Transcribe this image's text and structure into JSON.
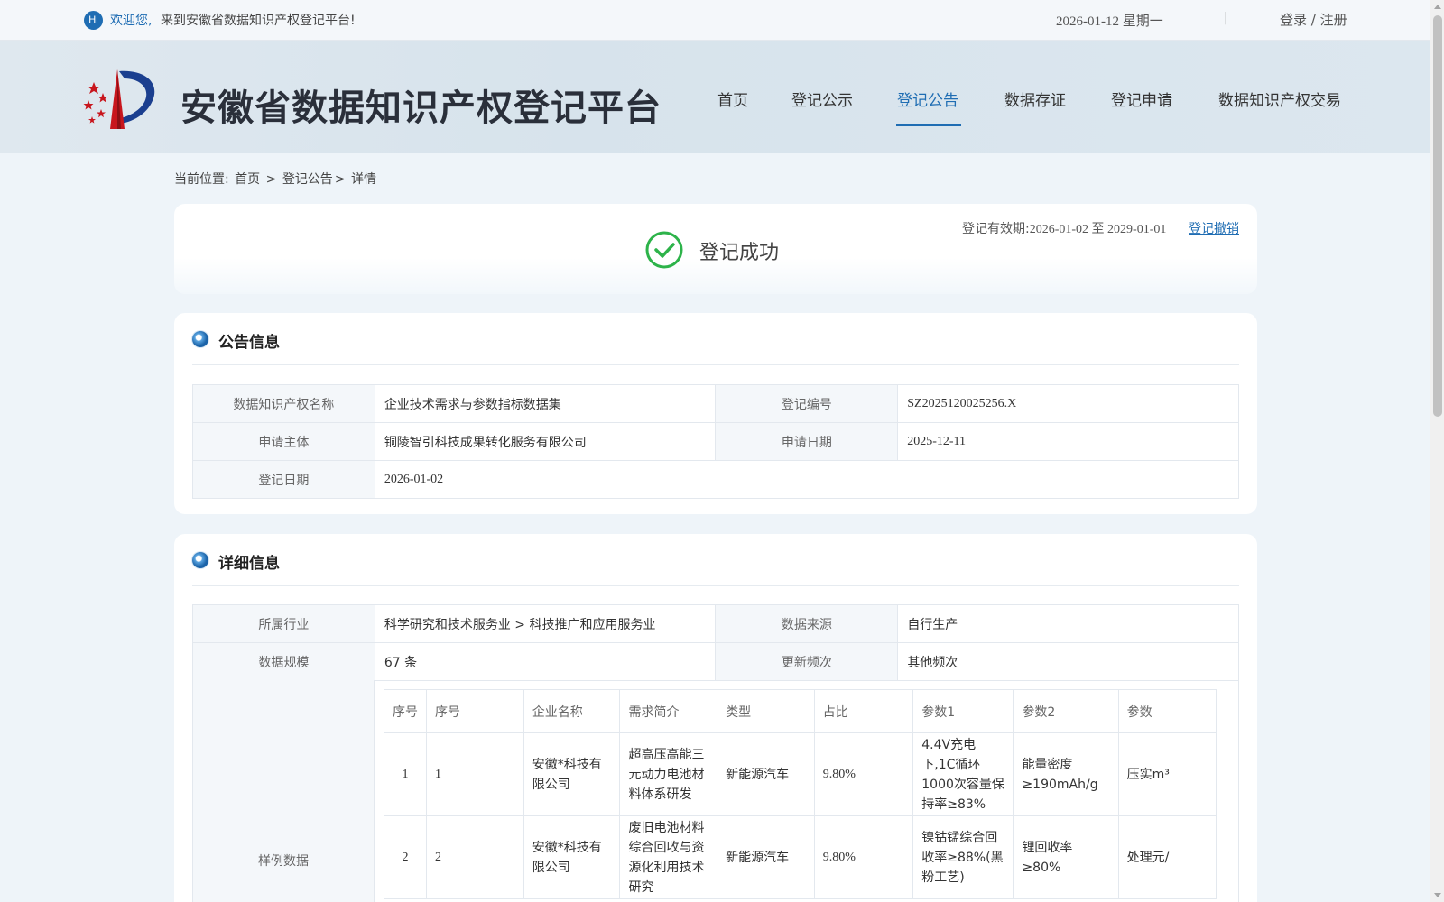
{
  "topbar": {
    "hi_badge": "Hi",
    "welcome_em": "欢迎您,",
    "welcome_text": "来到安徽省数据知识产权登记平台!",
    "date": "2026-01-12 星期一",
    "separator": "|",
    "auth_link": "登录 / 注册"
  },
  "header": {
    "site_title": "安徽省数据知识产权登记平台",
    "nav": [
      {
        "label": "首页"
      },
      {
        "label": "登记公示"
      },
      {
        "label": "登记公告"
      },
      {
        "label": "数据存证"
      },
      {
        "label": "登记申请"
      },
      {
        "label": "数据知识产权交易"
      }
    ],
    "active_nav": "登记公告",
    "accent_color": "#1f6db3"
  },
  "breadcrumb": {
    "prefix": "当前位置:",
    "home": "首页",
    "sep1": ">",
    "section": "登记公告",
    "sep2": ">",
    "current": "详情"
  },
  "status": {
    "text": "登记成功",
    "validity_label": "登记有效期:",
    "validity_dates": "2026-01-02 至 2029-01-01",
    "revoke_link": "登记撤销",
    "success_color": "#2db34a"
  },
  "announcement": {
    "title": "公告信息",
    "fields": {
      "name_label": "数据知识产权名称",
      "name_value": "企业技术需求与参数指标数据集",
      "reg_no_label": "登记编号",
      "reg_no_value": "SZ2025120025256.X",
      "applicant_label": "申请主体",
      "applicant_value": "铜陵智引科技成果转化服务有限公司",
      "apply_date_label": "申请日期",
      "apply_date_value": "2025-12-11",
      "reg_date_label": "登记日期",
      "reg_date_value": "2026-01-02"
    }
  },
  "details": {
    "title": "详细信息",
    "fields": {
      "industry_label": "所属行业",
      "industry_value": "科学研究和技术服务业 > 科技推广和应用服务业",
      "source_label": "数据来源",
      "source_value": "自行生产",
      "scale_label": "数据规模",
      "scale_value": "67 条",
      "frequency_label": "更新频次",
      "frequency_value": "其他频次",
      "sample_label": "样例数据"
    },
    "sample_table": {
      "headers": [
        "序号",
        "序号",
        "企业名称",
        "需求简介",
        "类型",
        "占比",
        "参数1",
        "参数2",
        "参数"
      ],
      "rows": [
        [
          "1",
          "1",
          "安徽*科技有限公司",
          "超高压高能三元动力电池材料体系研发",
          "新能源汽车",
          "9.80%",
          "4.4V充电下,1C循环1000次容量保持率≥83%",
          "能量密度≥190mAh/g",
          "压实m³"
        ],
        [
          "2",
          "2",
          "安徽*科技有限公司",
          "废旧电池材料综合回收与资源化利用技术研究",
          "新能源汽车",
          "9.80%",
          "镍钴锰综合回收率≥88%(黑粉工艺)",
          "锂回收率≥80%",
          "处理元/"
        ]
      ]
    }
  }
}
